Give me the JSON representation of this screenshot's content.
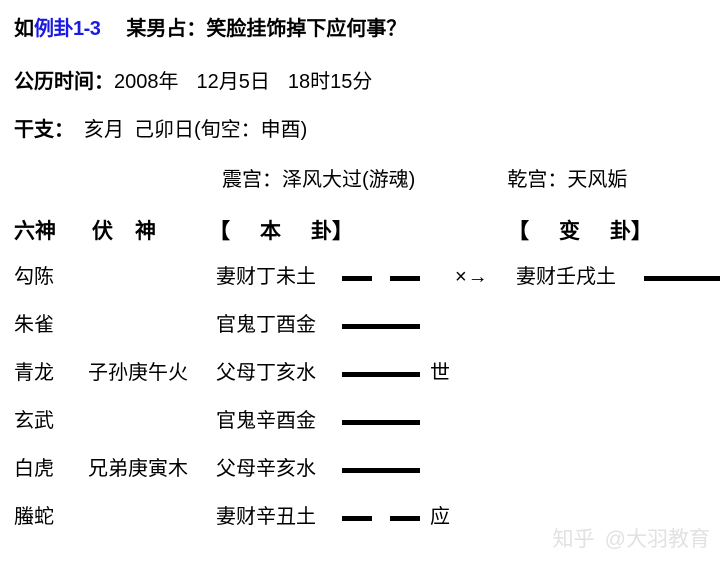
{
  "header": {
    "title_prefix": "如",
    "title_example_label": "例卦1-3",
    "title_question": "某男占：笑脸挂饰掉下应何事？",
    "title_example_color": "#1a1ae0",
    "date_label": "公历时间：",
    "date_year": "2008年",
    "date_day": "12月5日",
    "date_time": "18时15分",
    "ganzhi_label": "干支：",
    "ganzhi_month": "亥月",
    "ganzhi_day": "己卯日",
    "ganzhi_xunkong": "(旬空：申酉)"
  },
  "palaces": {
    "ben_gong": "震宫：泽风大过(游魂)",
    "bian_gong": "乾宫：天风姤"
  },
  "columns": {
    "liushen": "六神",
    "fushen_a": "伏",
    "fushen_b": "神",
    "ben_gua_open": "【本",
    "ben_gua_close": "卦】",
    "bian_gua_open": "【变",
    "bian_gua_close": "卦】"
  },
  "rows": [
    {
      "liushen": "勾陈",
      "fushen": "",
      "yao": "妻财丁未土",
      "line": "yin",
      "shiying": "",
      "change": "×→",
      "bian_yao": "妻财壬戌土",
      "bian_line": "yang"
    },
    {
      "liushen": "朱雀",
      "fushen": "",
      "yao": "官鬼丁酉金",
      "line": "yang",
      "shiying": "",
      "change": "",
      "bian_yao": "",
      "bian_line": ""
    },
    {
      "liushen": "青龙",
      "fushen": "子孙庚午火",
      "yao": "父母丁亥水",
      "line": "yang",
      "shiying": "世",
      "change": "",
      "bian_yao": "",
      "bian_line": ""
    },
    {
      "liushen": "玄武",
      "fushen": "",
      "yao": "官鬼辛酉金",
      "line": "yang",
      "shiying": "",
      "change": "",
      "bian_yao": "",
      "bian_line": ""
    },
    {
      "liushen": "白虎",
      "fushen": "兄弟庚寅木",
      "yao": "父母辛亥水",
      "line": "yang",
      "shiying": "",
      "change": "",
      "bian_yao": "",
      "bian_line": ""
    },
    {
      "liushen": "螣蛇",
      "fushen": "",
      "yao": "妻财辛丑土",
      "line": "yin",
      "shiying": "应",
      "change": "",
      "bian_yao": "",
      "bian_line": ""
    }
  ],
  "watermark": {
    "logo": "知乎",
    "handle": "@大羽教育",
    "color": "#e2e2e2"
  }
}
